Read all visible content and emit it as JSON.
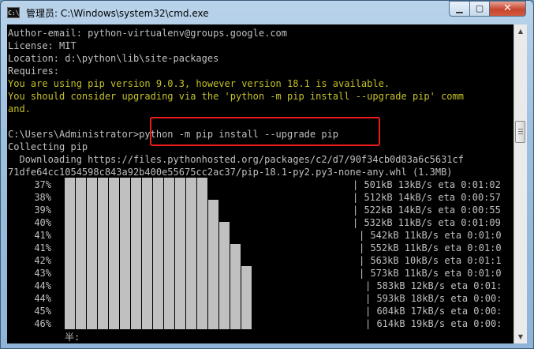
{
  "window": {
    "title": "管理员: C:\\Windows\\system32\\cmd.exe",
    "icon": "cmd-icon",
    "icon_text": "C:\\",
    "minimize_glyph": "▁",
    "maximize_glyph": "▢",
    "close_glyph": "✕"
  },
  "console": {
    "lines": [
      {
        "text": "Author-email: python-virtualenv@groups.google.com",
        "style": "normal"
      },
      {
        "text": "License: MIT",
        "style": "normal"
      },
      {
        "text": "Location: d:\\python\\lib\\site-packages",
        "style": "normal"
      },
      {
        "text": "Requires:",
        "style": "normal"
      },
      {
        "text": "You are using pip version 9.0.3, however version 18.1 is available.",
        "style": "warn"
      },
      {
        "text": "You should consider upgrading via the 'python -m pip install --upgrade pip' comm",
        "style": "warn"
      },
      {
        "text": "and.",
        "style": "warn"
      },
      {
        "text": "",
        "style": "normal"
      },
      {
        "text": "C:\\Users\\Administrator>python -m pip install --upgrade pip",
        "style": "normal"
      },
      {
        "text": "Collecting pip",
        "style": "normal"
      },
      {
        "text": "  Downloading https://files.pythonhosted.org/packages/c2/d7/90f34cb0d83a6c5631cf",
        "style": "normal"
      },
      {
        "text": "71dfe64cc1054598c843a92b400e55675cc2ac37/pip-18.1-py2.py3-none-any.whl (1.3MB)",
        "style": "normal"
      }
    ],
    "warn_color": "#c4c12a",
    "text_color": "#c0c0c0",
    "highlight_color": "#ee1b1b",
    "progress": [
      {
        "pct": "37%",
        "stat": "| 501kB 13kB/s eta 0:01:02"
      },
      {
        "pct": "38%",
        "stat": "| 512kB 14kB/s eta 0:00:57"
      },
      {
        "pct": "39%",
        "stat": "| 522kB 14kB/s eta 0:00:55"
      },
      {
        "pct": "40%",
        "stat": "| 532kB 11kB/s eta 0:01:09"
      },
      {
        "pct": "41%",
        "stat": "| 542kB 11kB/s eta 0:01:0"
      },
      {
        "pct": "41%",
        "stat": "| 552kB 11kB/s eta 0:01:0"
      },
      {
        "pct": "42%",
        "stat": "| 563kB 10kB/s eta 0:01:1"
      },
      {
        "pct": "43%",
        "stat": "| 573kB 11kB/s eta 0:01:0"
      },
      {
        "pct": "44%",
        "stat": "| 583kB 12kB/s eta 0:01:"
      },
      {
        "pct": "44%",
        "stat": "| 593kB 18kB/s eta 0:00:"
      },
      {
        "pct": "45%",
        "stat": "| 604kB 17kB/s eta 0:00:"
      },
      {
        "pct": "46%",
        "stat": "| 614kB 19kB/s eta 0:00:"
      }
    ],
    "ime_status": "半:"
  },
  "scrollbar": {
    "up_glyph": "▲",
    "down_glyph": "▼"
  }
}
